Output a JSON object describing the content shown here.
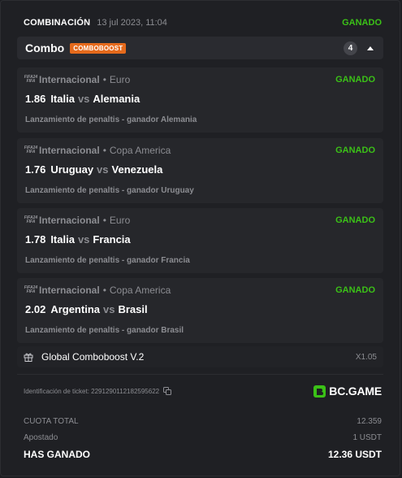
{
  "header": {
    "title": "COMBINACIÓN",
    "date": "13 jul 2023, 11:04",
    "status": "GANADO"
  },
  "combo": {
    "label": "Combo",
    "badge": "COMBOBOOST",
    "count": "4"
  },
  "logo_text": [
    "FIFA24",
    "FIFA",
    "FIFA"
  ],
  "bets": [
    {
      "league": "Internacional",
      "competition": "Euro",
      "status": "GANADO",
      "odds": "1.86",
      "home": "Italia",
      "vs": "vs",
      "away": "Alemania",
      "pick": "Lanzamiento de penaltis - ganador Alemania"
    },
    {
      "league": "Internacional",
      "competition": "Copa America",
      "status": "GANADO",
      "odds": "1.76",
      "home": "Uruguay",
      "vs": "vs",
      "away": "Venezuela",
      "pick": "Lanzamiento de penaltis - ganador Uruguay"
    },
    {
      "league": "Internacional",
      "competition": "Euro",
      "status": "GANADO",
      "odds": "1.78",
      "home": "Italia",
      "vs": "vs",
      "away": "Francia",
      "pick": "Lanzamiento de penaltis - ganador Francia"
    },
    {
      "league": "Internacional",
      "competition": "Copa America",
      "status": "GANADO",
      "odds": "2.02",
      "home": "Argentina",
      "vs": "vs",
      "away": "Brasil",
      "pick": "Lanzamiento de penaltis - ganador Brasil"
    }
  ],
  "boost": {
    "name": "Global Comboboost V.2",
    "multiplier": "X1.05"
  },
  "ticket": {
    "label": "Identificación de ticket: 2291290112182595622"
  },
  "brand": {
    "name": "BC.GAME"
  },
  "totals": {
    "cuota_label": "CUOTA TOTAL",
    "cuota_value": "12.359",
    "apostado_label": "Apostado",
    "apostado_value": "1 USDT",
    "ganado_label": "HAS GANADO",
    "ganado_value": "12.36 USDT"
  },
  "colors": {
    "win_green": "#3bc117",
    "badge_orange": "#e56a1c",
    "brand_green": "#3bc117"
  }
}
